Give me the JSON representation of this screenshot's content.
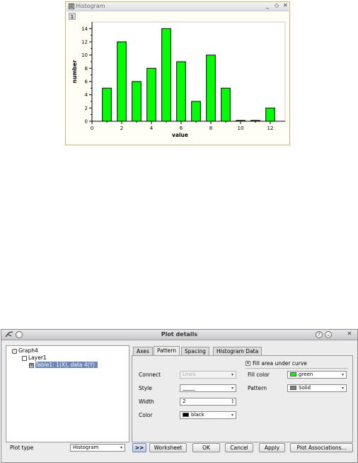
{
  "histogram_window": {
    "title": "Histogram",
    "controls": {
      "minimize": "_",
      "restore": "◇",
      "close": "✕"
    },
    "layer_tab": "1"
  },
  "chart_data": {
    "type": "bar",
    "title": "",
    "xlabel": "value",
    "ylabel": "number",
    "x": [
      1,
      2,
      3,
      4,
      5,
      6,
      7,
      8,
      9,
      10,
      11,
      12
    ],
    "values": [
      5,
      12,
      6,
      8,
      14,
      9,
      3,
      10,
      5,
      0,
      0,
      2
    ],
    "xlim": [
      0,
      13
    ],
    "ylim": [
      0,
      15
    ],
    "xticks": [
      0,
      2,
      4,
      6,
      8,
      10,
      12
    ],
    "yticks": [
      0,
      2,
      4,
      6,
      8,
      10,
      12,
      14
    ],
    "bar_color": "#00ff00",
    "bar_edge_color": "#000000",
    "grid": false,
    "legend": "none"
  },
  "dialog": {
    "title": "Plot details",
    "title_buttons": {
      "help": "?",
      "menu": "⌄",
      "close": "✕"
    },
    "tree": {
      "graph": "Graph4",
      "layer": "Layer1",
      "curve": "Table1: 1(X), data 4(Y)"
    },
    "tabs": [
      "Axes",
      "Pattern",
      "Spacing",
      "Histogram Data"
    ],
    "active_tab": "Pattern",
    "pattern": {
      "connect_label": "Connect",
      "connect_value": "Lines",
      "style_label": "Style",
      "style_value": "_____",
      "width_label": "Width",
      "width_value": "2",
      "color_label": "Color",
      "color_value": "black",
      "fill_checkbox_label": "Fill area under curve",
      "fill_checked": true,
      "fill_color_label": "Fill color",
      "fill_color_value": "green",
      "pattern_label": "Pattern",
      "pattern_value": "Solid"
    },
    "bottom": {
      "plot_type_label": "Plot type",
      "plot_type_value": "Histogram",
      "expand_label": ">>",
      "worksheet_label": "Worksheet",
      "ok_label": "OK",
      "cancel_label": "Cancel",
      "apply_label": "Apply",
      "associations_label": "Plot Associations..."
    },
    "colors": {
      "black": "#000000",
      "green": "#00ff00",
      "solid": "#808080",
      "selection": "#6a85b8"
    }
  }
}
